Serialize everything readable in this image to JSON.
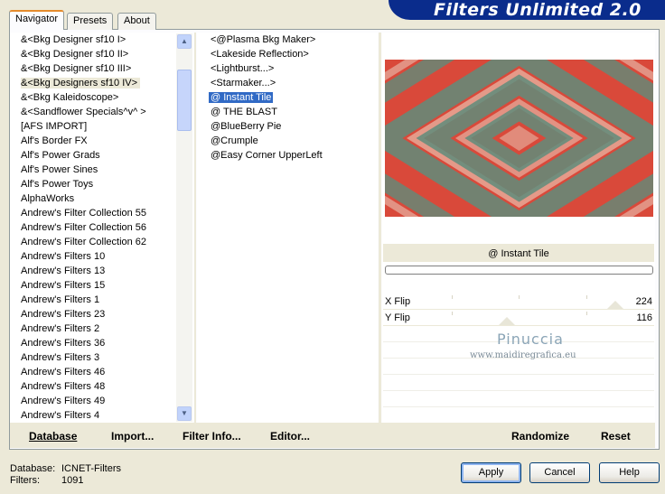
{
  "app": {
    "title": "Filters Unlimited 2.0"
  },
  "tabs": [
    {
      "label": "Navigator",
      "active": true
    },
    {
      "label": "Presets",
      "active": false
    },
    {
      "label": "About",
      "active": false
    }
  ],
  "categories": {
    "selected_index": 3,
    "items": [
      "&<Bkg Designer sf10 I>",
      "&<Bkg Designer sf10 II>",
      "&<Bkg Designer sf10 III>",
      "&<Bkg Designers sf10 IV>",
      "&<Bkg Kaleidoscope>",
      "&<Sandflower Specials^v^ >",
      "[AFS IMPORT]",
      "Alf's Border FX",
      "Alf's Power Grads",
      "Alf's Power Sines",
      "Alf's Power Toys",
      "AlphaWorks",
      "Andrew's Filter Collection 55",
      "Andrew's Filter Collection 56",
      "Andrew's Filter Collection 62",
      "Andrew's Filters 10",
      "Andrew's Filters 13",
      "Andrew's Filters 15",
      "Andrew's Filters 1",
      "Andrew's Filters 23",
      "Andrew's Filters 2",
      "Andrew's Filters 36",
      "Andrew's Filters 3",
      "Andrew's Filters 46",
      "Andrew's Filters 48",
      "Andrew's Filters 49",
      "Andrew's Filters 4"
    ]
  },
  "filters": {
    "selected_index": 4,
    "items": [
      "<@Plasma Bkg Maker>",
      "<Lakeside Reflection>",
      "<Lightburst...>",
      "<Starmaker...>",
      "@ Instant Tile",
      "@ THE BLAST",
      "@BlueBerry Pie",
      "@Crumple",
      "@Easy Corner UpperLeft"
    ]
  },
  "preview": {
    "filter_name": "@ Instant Tile",
    "progress": 0,
    "colors": {
      "red": "#d9493a",
      "teal": "#5f8c7b",
      "light": "#ecdccb"
    }
  },
  "params": [
    {
      "label": "X Flip",
      "value": "224",
      "level": 224
    },
    {
      "label": "Y Flip",
      "value": "116",
      "level": 116
    }
  ],
  "watermark": {
    "name": "Pinuccia",
    "url": "www.maidiregrafica.eu"
  },
  "actions": {
    "database": "Database",
    "import": "Import...",
    "filter_info": "Filter Info...",
    "editor": "Editor...",
    "randomize": "Randomize",
    "reset": "Reset"
  },
  "status": {
    "database_label": "Database:",
    "database_value": "ICNET-Filters",
    "filters_label": "Filters:",
    "filters_value": "1091"
  },
  "buttons": {
    "apply": "Apply",
    "cancel": "Cancel",
    "help": "Help"
  }
}
